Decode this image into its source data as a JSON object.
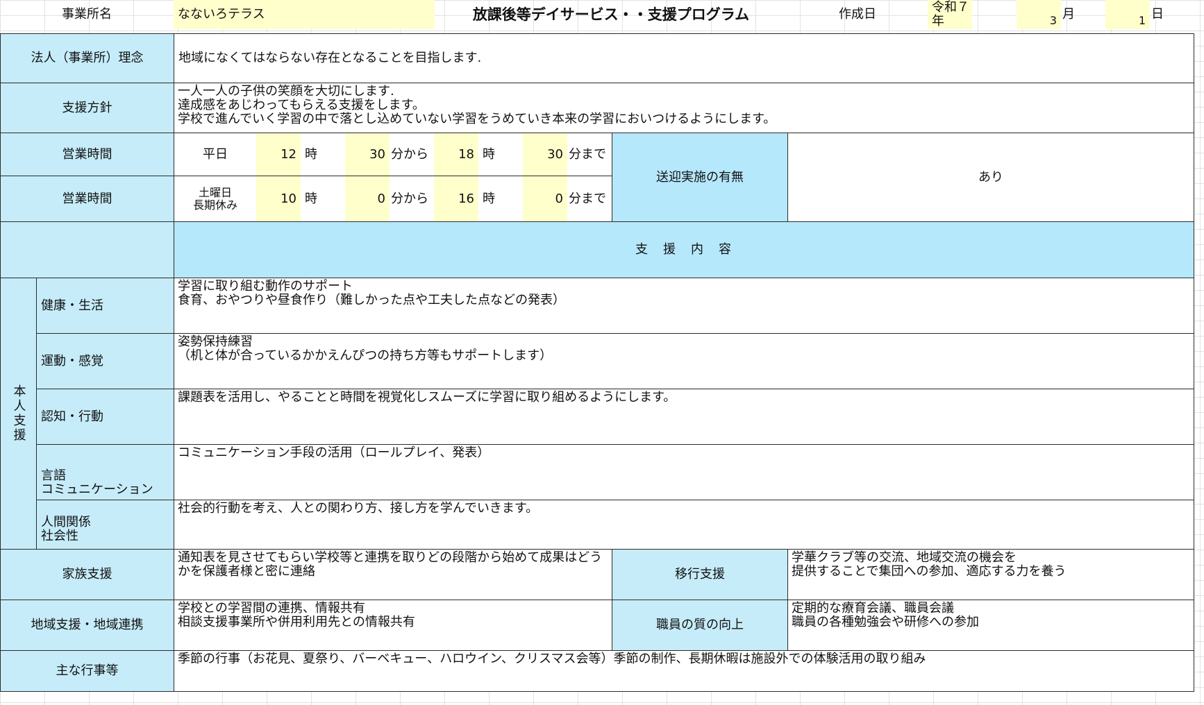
{
  "header": {
    "office_label": "事業所名",
    "office_name": "なないろテラス",
    "title": "放課後等デイサービス・・支援プログラム",
    "created_label": "作成日",
    "era_year": "令和７年",
    "month_value": "3",
    "month_label": "月",
    "day_value": "1",
    "day_label": "日"
  },
  "philosophy": {
    "label": "法人（事業所）理念",
    "text": "地域になくてはならない存在となることを目指します."
  },
  "policy": {
    "label": "支援方針",
    "text": "一人一人の子供の笑顔を大切にします.\n達成感をあじわってもらえる支援をします。\n学校で進んでいく学習の中で落とし込めていない学習をうめていき本来の学習においつけるようにします。"
  },
  "hours_weekday": {
    "label": "営業時間",
    "day_type": "平日",
    "start_hour": "12",
    "hour_unit": "時",
    "start_min": "30",
    "from_unit": "分から",
    "end_hour": "18",
    "end_min": "30",
    "until_unit": "分まで"
  },
  "hours_weekend": {
    "label": "営業時間",
    "day_type": "土曜日\n長期休み",
    "start_hour": "10",
    "hour_unit": "時",
    "start_min": "0",
    "from_unit": "分から",
    "end_hour": "16",
    "end_min": "0",
    "until_unit": "分まで"
  },
  "transport": {
    "label": "送迎実施の有無",
    "value": "あり"
  },
  "support_content_header": "支　援　内　容",
  "personal_support": {
    "label": "本人支援",
    "items": [
      {
        "label": "健康・生活",
        "text": "学習に取り組む動作のサポート\n食育、おやつりや昼食作り（難しかった点や工夫した点などの発表）"
      },
      {
        "label": "運動・感覚",
        "text": "姿勢保持練習\n（机と体が合っているかかえんぴつの持ち方等もサポートします）"
      },
      {
        "label": "認知・行動",
        "text": "課題表を活用し、やることと時間を視覚化しスムーズに学習に取り組めるようにします。"
      },
      {
        "label": "言語\nコミュニケーション",
        "text": "コミュニケーション手段の活用（ロールプレイ、発表）"
      },
      {
        "label": "人間関係\n社会性",
        "text": "社会的行動を考え、人との関わり方、接し方を学んでいきます。"
      }
    ]
  },
  "family_support": {
    "label": "家族支援",
    "text": "通知表を見させてもらい学校等と連携を取りどの段階から始めて成果はどう\nかを保護者様と密に連絡"
  },
  "transition_support": {
    "label": "移行支援",
    "text": "学華クラブ等の交流、地域交流の機会を\n提供することで集団への参加、適応する力を養う"
  },
  "community_support": {
    "label": "地域支援・地域連携",
    "text": "学校との学習間の連携、情報共有\n相談支援事業所や併用利用先との情報共有"
  },
  "staff_quality": {
    "label": "職員の質の向上",
    "text": "定期的な療育会議、職員会議\n職員の各種勉強会や研修への参加"
  },
  "events": {
    "label": "主な行事等",
    "text": "季節の行事（お花見、夏祭り、バーベキュー、ハロウイン、クリスマス会等）季節の制作、長期休暇は施設外での体験活用の取り組み"
  },
  "colors": {
    "label_fill": "#c6ecf9",
    "input_fill": "#ffffcc",
    "header_fill": "#b6e8fb"
  }
}
